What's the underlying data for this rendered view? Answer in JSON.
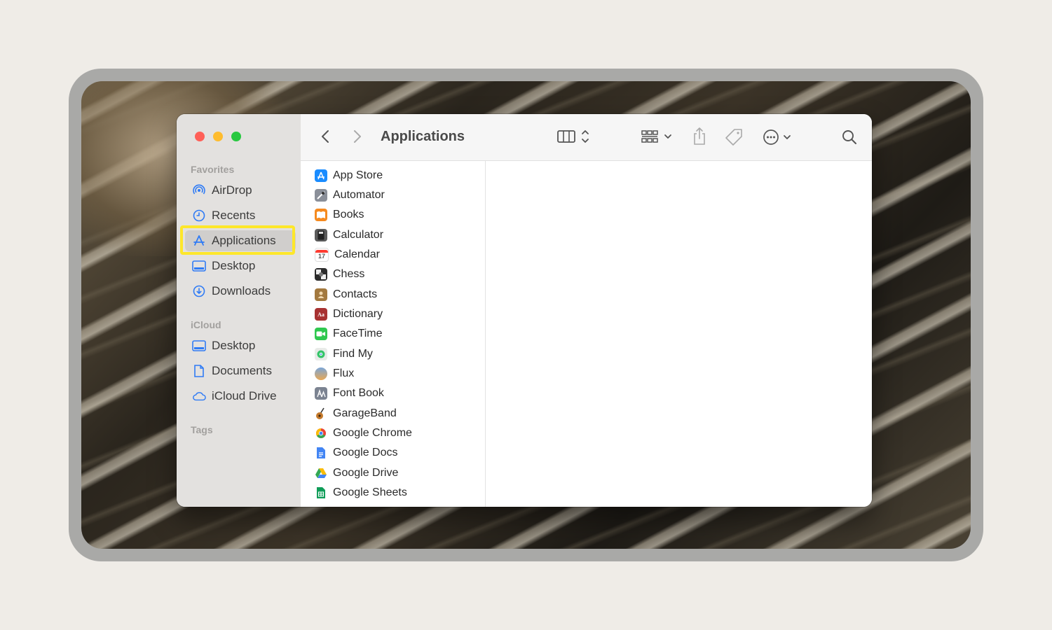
{
  "window": {
    "title": "Applications"
  },
  "sidebar": {
    "sections": [
      {
        "title": "Favorites",
        "items": [
          {
            "label": "AirDrop",
            "icon": "airdrop-icon"
          },
          {
            "label": "Recents",
            "icon": "clock-icon"
          },
          {
            "label": "Applications",
            "icon": "applications-icon",
            "selected": true
          },
          {
            "label": "Desktop",
            "icon": "desktop-icon"
          },
          {
            "label": "Downloads",
            "icon": "download-icon"
          }
        ]
      },
      {
        "title": "iCloud",
        "items": [
          {
            "label": "Desktop",
            "icon": "desktop-icon"
          },
          {
            "label": "Documents",
            "icon": "document-icon"
          },
          {
            "label": "iCloud Drive",
            "icon": "cloud-icon"
          }
        ]
      },
      {
        "title": "Tags",
        "items": []
      }
    ]
  },
  "toolbar": {
    "back": "back-chevron-icon",
    "forward": "forward-chevron-icon",
    "view": "column-view-icon",
    "group": "group-grid-icon",
    "share": "share-icon",
    "tag": "tag-icon",
    "more": "ellipsis-circle-icon",
    "search": "search-icon"
  },
  "apps": [
    {
      "name": "App Store",
      "color": "#1a8cff"
    },
    {
      "name": "Automator",
      "color": "#8a8f99"
    },
    {
      "name": "Books",
      "color": "#f58a1f"
    },
    {
      "name": "Calculator",
      "color": "#5b5b5b"
    },
    {
      "name": "Calendar",
      "color": "#ffffff"
    },
    {
      "name": "Chess",
      "color": "#2c2c2c"
    },
    {
      "name": "Contacts",
      "color": "#a3793f"
    },
    {
      "name": "Dictionary",
      "color": "#a83232"
    },
    {
      "name": "FaceTime",
      "color": "#2fc84f"
    },
    {
      "name": "Find My",
      "color": "#35c46a"
    },
    {
      "name": "Flux",
      "color": "#e9a855"
    },
    {
      "name": "Font Book",
      "color": "#7b8391"
    },
    {
      "name": "GarageBand",
      "color": "#8b5a2b"
    },
    {
      "name": "Google Chrome",
      "color": "#ea4335"
    },
    {
      "name": "Google Docs",
      "color": "#4285f4"
    },
    {
      "name": "Google Drive",
      "color": "#34a853"
    },
    {
      "name": "Google Sheets",
      "color": "#0f9d58"
    }
  ],
  "calendar_icon_day": "17",
  "dictionary_icon_text": "Aa"
}
